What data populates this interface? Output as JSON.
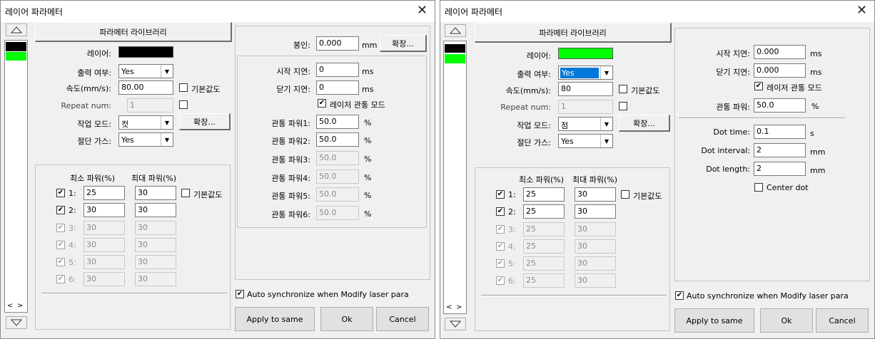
{
  "dialog_left": {
    "title": "레이어 파라메터",
    "param_library_label": "파라메터 라이브러리",
    "layer_label": "레이어:",
    "layer_color": "#000000",
    "output_label": "출력 여부:",
    "output_value": "Yes",
    "speed_label": "속도(mm/s):",
    "speed_value": "80.00",
    "default_label": "기본값도",
    "repeat_label": "Repeat num:",
    "repeat_value": "1",
    "mode_label": "작업 모드:",
    "mode_value": "컷",
    "expand_label": "확장...",
    "gas_label": "절단 가스:",
    "gas_value": "Yes",
    "min_power_header": "최소 파워(%)",
    "max_power_header": "최대 파워(%)",
    "power_default_label": "기본값도",
    "power_rows": [
      {
        "label": "1:",
        "min": "25",
        "max": "30"
      },
      {
        "label": "2:",
        "min": "30",
        "max": "30"
      },
      {
        "label": "3:",
        "min": "30",
        "max": "30"
      },
      {
        "label": "4:",
        "min": "30",
        "max": "30"
      },
      {
        "label": "5:",
        "min": "30",
        "max": "30"
      },
      {
        "label": "6:",
        "min": "30",
        "max": "30"
      }
    ],
    "seal_label": "봉인:",
    "seal_value": "0.000",
    "seal_unit": "mm",
    "seal_expand_label": "확장...",
    "start_delay_label": "시작 지연:",
    "start_delay_value": "0",
    "close_delay_label": "닫기 지연:",
    "close_delay_value": "0",
    "ms_unit": "ms",
    "through_mode_label": "레이저 관통 모드",
    "through_rows": [
      {
        "label": "관통 파워1:",
        "value": "50.0"
      },
      {
        "label": "관통 파워2:",
        "value": "50.0"
      },
      {
        "label": "관통 파워3:",
        "value": "50.0"
      },
      {
        "label": "관통 파워4:",
        "value": "50.0"
      },
      {
        "label": "관통 파워5:",
        "value": "50.0"
      },
      {
        "label": "관통 파워6:",
        "value": "50.0"
      }
    ],
    "percent_unit": "%",
    "auto_sync_label": "Auto synchronize when Modify laser para",
    "apply_label": "Apply to same",
    "ok_label": "Ok",
    "cancel_label": "Cancel",
    "scroll_left": "<",
    "scroll_right": ">"
  },
  "dialog_right": {
    "title": "레이어 파라메터",
    "param_library_label": "파라메터 라이브러리",
    "layer_label": "레이어:",
    "layer_color": "#00ff00",
    "output_label": "출력 여부:",
    "output_value": "Yes",
    "speed_label": "속도(mm/s):",
    "speed_value": "80",
    "default_label": "기본값도",
    "repeat_label": "Repeat num:",
    "repeat_value": "1",
    "mode_label": "작업 모드:",
    "mode_value": "점",
    "expand_label": "확장...",
    "gas_label": "절단 가스:",
    "gas_value": "Yes",
    "min_power_header": "최소 파워(%)",
    "max_power_header": "최대 파워(%)",
    "power_default_label": "기본값도",
    "power_rows": [
      {
        "label": "1:",
        "min": "25",
        "max": "30"
      },
      {
        "label": "2:",
        "min": "25",
        "max": "30"
      },
      {
        "label": "3:",
        "min": "25",
        "max": "30"
      },
      {
        "label": "4:",
        "min": "25",
        "max": "30"
      },
      {
        "label": "5:",
        "min": "25",
        "max": "30"
      },
      {
        "label": "6:",
        "min": "25",
        "max": "30"
      }
    ],
    "start_delay_label": "시작 지연:",
    "start_delay_value": "0.000",
    "close_delay_label": "닫기 지연:",
    "close_delay_value": "0.000",
    "ms_unit": "ms",
    "through_mode_label": "레이저 관통 모드",
    "through_power_label": "관통 파워:",
    "through_power_value": "50.0",
    "percent_unit": "%",
    "dot_time_label": "Dot time:",
    "dot_time_value": "0.1",
    "dot_time_unit": "s",
    "dot_interval_label": "Dot interval:",
    "dot_interval_value": "2",
    "dot_length_label": "Dot length:",
    "dot_length_value": "2",
    "mm_unit": "mm",
    "center_dot_label": "Center dot",
    "auto_sync_label": "Auto synchronize when Modify laser para",
    "apply_label": "Apply to same",
    "ok_label": "Ok",
    "cancel_label": "Cancel",
    "scroll_left": "<",
    "scroll_right": ">"
  }
}
